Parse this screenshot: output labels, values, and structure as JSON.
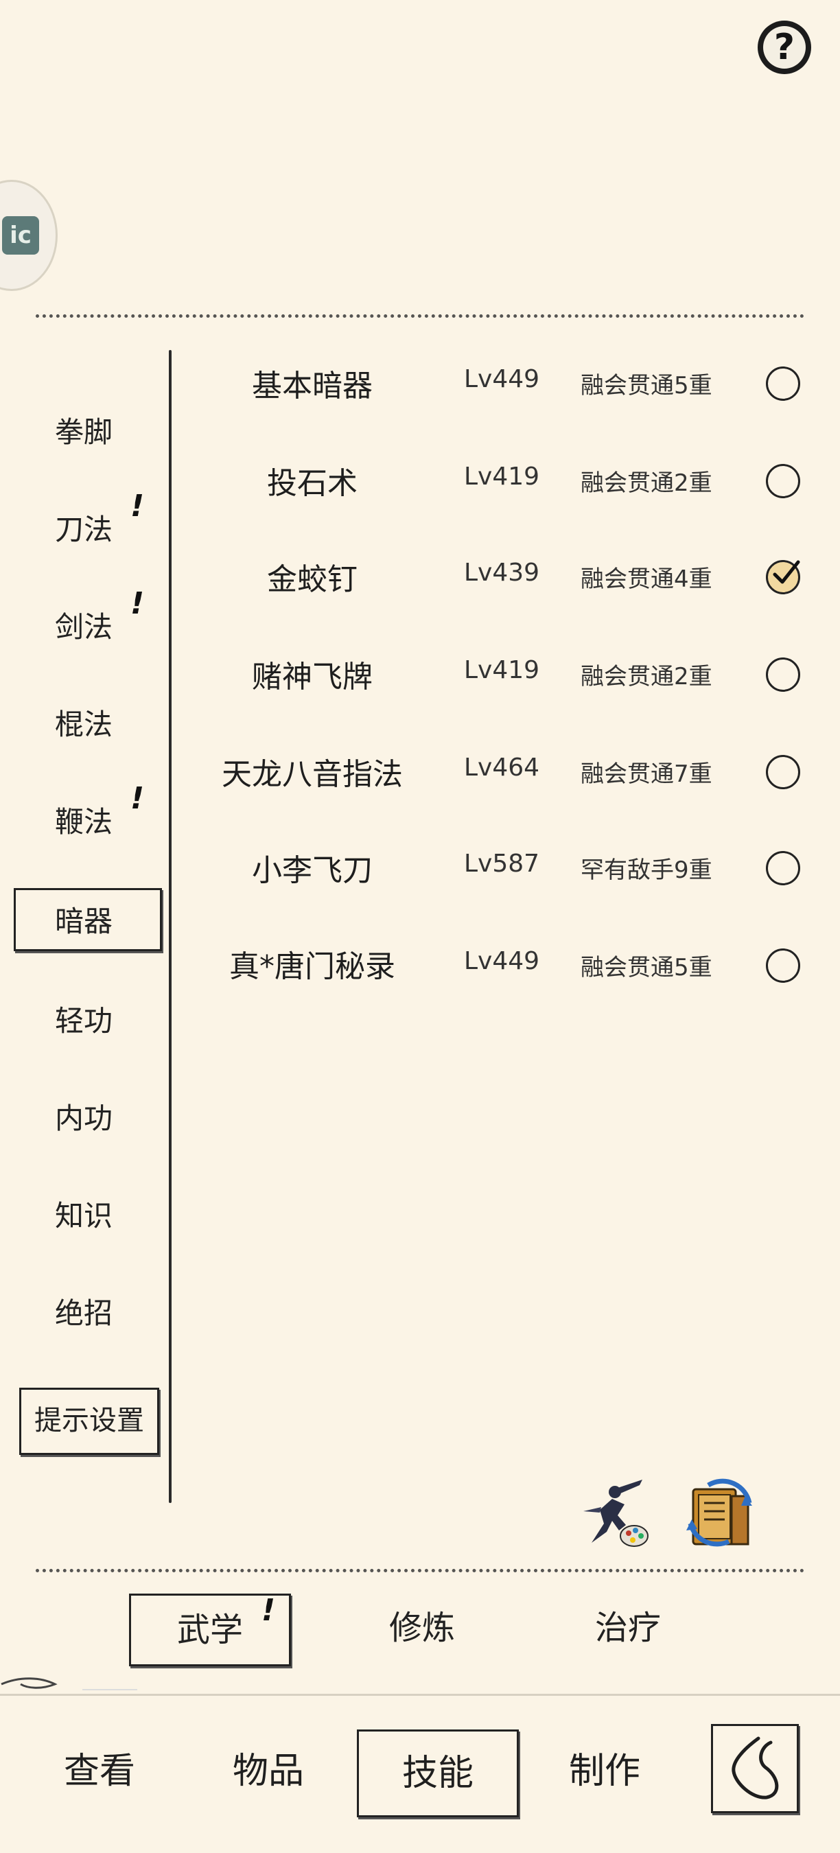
{
  "header": {
    "help_label": "?",
    "avatar_badge": "ic"
  },
  "categories": [
    {
      "label": "拳脚",
      "alert": false
    },
    {
      "label": "刀法",
      "alert": true
    },
    {
      "label": "剑法",
      "alert": true
    },
    {
      "label": "棍法",
      "alert": false
    },
    {
      "label": "鞭法",
      "alert": true
    },
    {
      "label": "暗器",
      "alert": false,
      "active": true
    },
    {
      "label": "轻功",
      "alert": false
    },
    {
      "label": "内功",
      "alert": false
    },
    {
      "label": "知识",
      "alert": false
    },
    {
      "label": "绝招",
      "alert": false
    }
  ],
  "alert_mark": "!",
  "tip_settings_label": "提示设置",
  "skills": [
    {
      "name": "基本暗器",
      "level": "Lv449",
      "rank": "融会贯通5重",
      "selected": false
    },
    {
      "name": "投石术",
      "level": "Lv419",
      "rank": "融会贯通2重",
      "selected": false
    },
    {
      "name": "金蛟钉",
      "level": "Lv439",
      "rank": "融会贯通4重",
      "selected": true
    },
    {
      "name": "赌神飞牌",
      "level": "Lv419",
      "rank": "融会贯通2重",
      "selected": false
    },
    {
      "name": "天龙八音指法",
      "level": "Lv464",
      "rank": "融会贯通7重",
      "selected": false
    },
    {
      "name": "小李飞刀",
      "level": "Lv587",
      "rank": "罕有敌手9重",
      "selected": false
    },
    {
      "name": "真*唐门秘录",
      "level": "Lv449",
      "rank": "融会贯通5重",
      "selected": false
    }
  ],
  "tools": {
    "left_icon": "martial-artist-palette-icon",
    "right_icon": "book-swap-icon"
  },
  "subtabs": [
    {
      "label": "武学",
      "active": true,
      "alert": true
    },
    {
      "label": "修炼",
      "active": false,
      "alert": false
    },
    {
      "label": "治疗",
      "active": false,
      "alert": false
    }
  ],
  "bottom_nav": [
    {
      "label": "查看",
      "active": false
    },
    {
      "label": "物品",
      "active": false
    },
    {
      "label": "技能",
      "active": true
    },
    {
      "label": "制作",
      "active": false
    }
  ],
  "colors": {
    "background": "#fbf4e6",
    "ink": "#1a1a1a",
    "checked_fill": "#f2d9a0"
  }
}
